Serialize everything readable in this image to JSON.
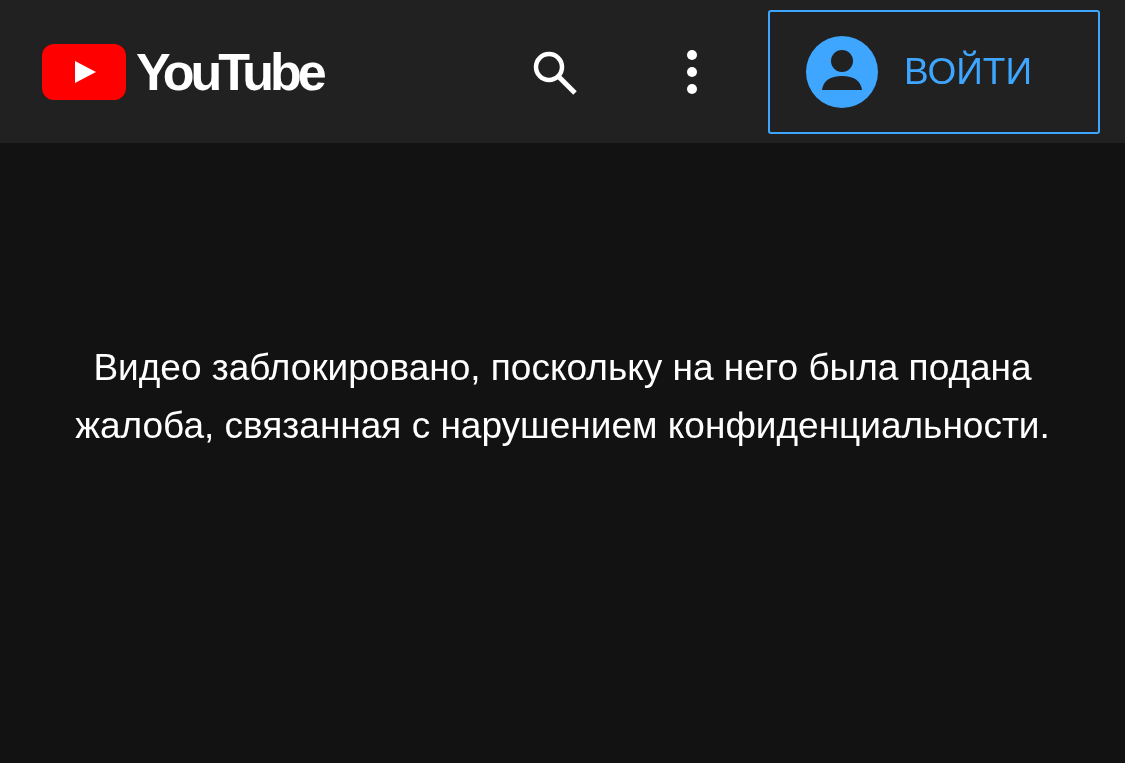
{
  "header": {
    "logo_text": "YouTube",
    "sign_in_label": "ВОЙТИ"
  },
  "message": "Видео заблокировано, поскольку на него была подана жалоба, связанная с нарушением конфиденциальности."
}
